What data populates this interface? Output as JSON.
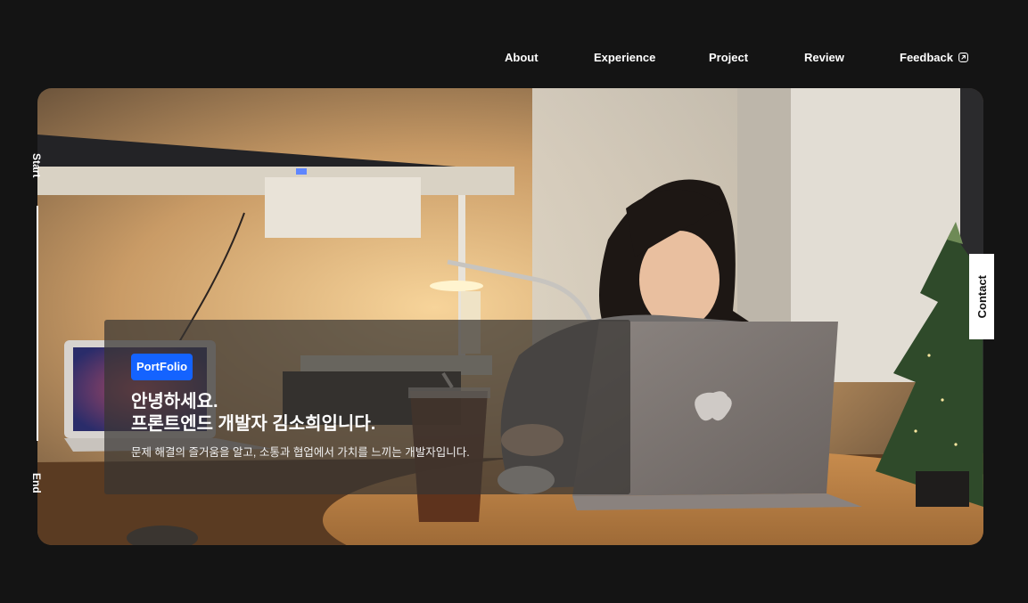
{
  "nav": {
    "items": [
      {
        "label": "About"
      },
      {
        "label": "Experience"
      },
      {
        "label": "Project"
      },
      {
        "label": "Review"
      },
      {
        "label": "Feedback"
      }
    ],
    "feedback_icon": "external-link-icon"
  },
  "hero": {
    "badge": "PortFolio",
    "headline_line1": "안녕하세요.",
    "headline_line2": "프론트엔드 개발자 김소희입니다.",
    "subline": "문제 해결의 즐거움을 알고, 소통과 협업에서 가치를 느끼는 개발자입니다."
  },
  "scroll_indicator": {
    "start": "Start",
    "end": "End"
  },
  "contact": {
    "label": "Contact"
  },
  "colors": {
    "background": "#141414",
    "badge": "#1463ff"
  }
}
